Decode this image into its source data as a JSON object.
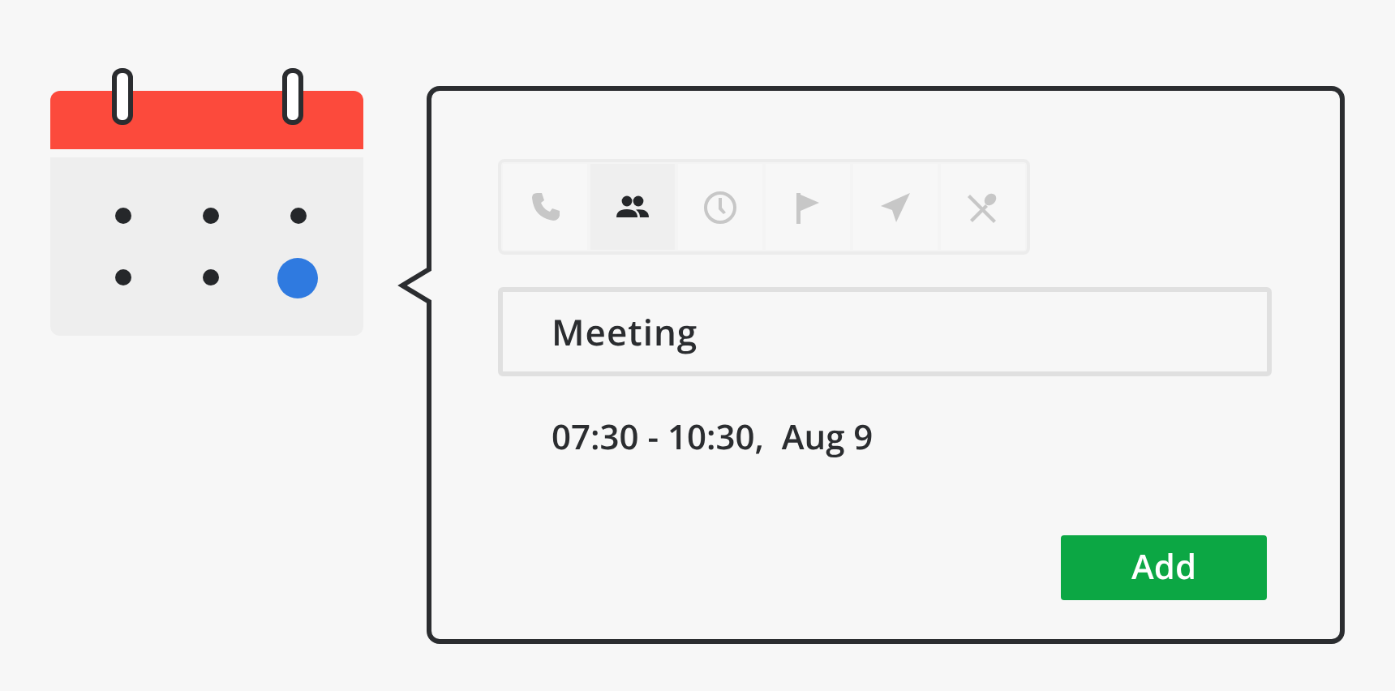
{
  "calendar": {
    "days": [
      {
        "selected": false
      },
      {
        "selected": false
      },
      {
        "selected": false
      },
      {
        "selected": false
      },
      {
        "selected": false
      },
      {
        "selected": true
      }
    ]
  },
  "event_popover": {
    "categories": [
      {
        "kind": "phone",
        "selected": false
      },
      {
        "kind": "people",
        "selected": true
      },
      {
        "kind": "clock",
        "selected": false
      },
      {
        "kind": "flag",
        "selected": false
      },
      {
        "kind": "send",
        "selected": false
      },
      {
        "kind": "food",
        "selected": false
      }
    ],
    "title_field": {
      "value": "Meeting"
    },
    "time_text": "07:30 - 10:30,  Aug 9",
    "add_button": "Add"
  }
}
